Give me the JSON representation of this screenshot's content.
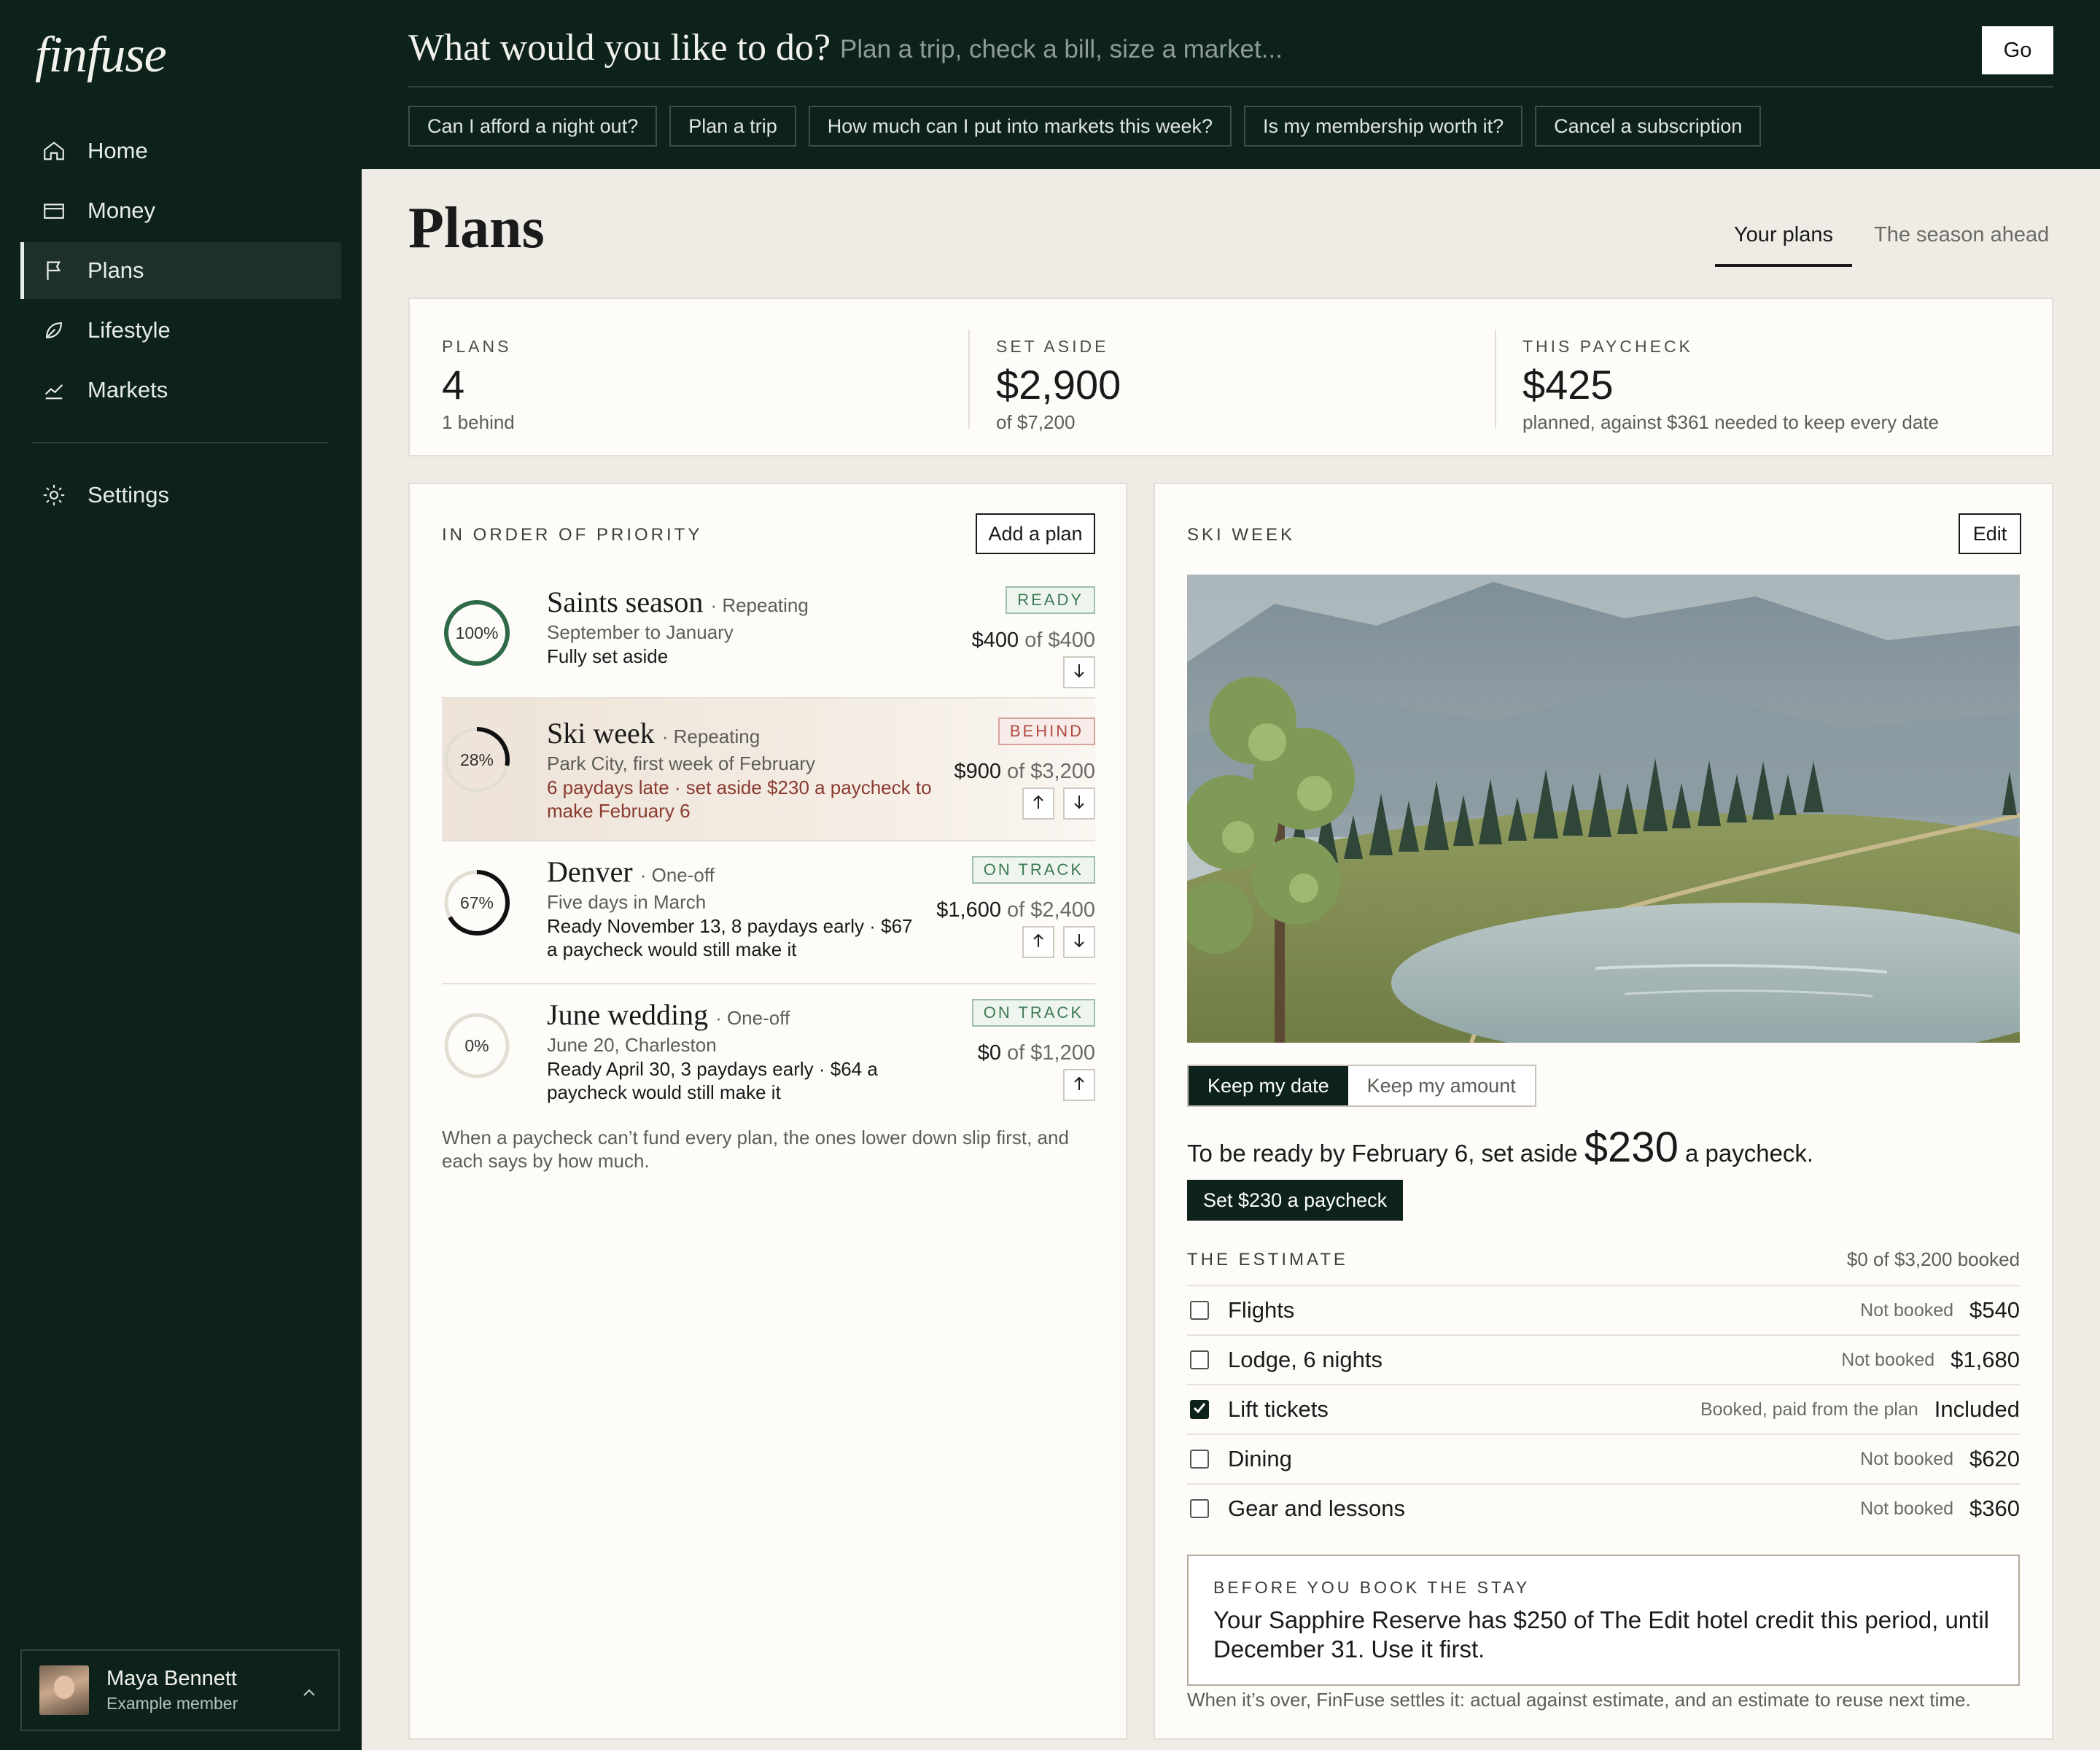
{
  "app": {
    "logo": "finfuse"
  },
  "sidebar": {
    "items": [
      {
        "label": "Home",
        "icon": "home-icon"
      },
      {
        "label": "Money",
        "icon": "wallet-icon"
      },
      {
        "label": "Plans",
        "icon": "flag-icon",
        "active": true
      },
      {
        "label": "Lifestyle",
        "icon": "leaf-icon"
      },
      {
        "label": "Markets",
        "icon": "chart-icon"
      }
    ],
    "settings": {
      "label": "Settings",
      "icon": "gear-icon"
    },
    "user": {
      "name": "Maya Bennett",
      "role": "Example member"
    }
  },
  "topbar": {
    "title": "What would you like to do?",
    "placeholder": "Plan a trip, check a bill, size a market...",
    "go_label": "Go",
    "chips": [
      "Can I afford a night out?",
      "Plan a trip",
      "How much can I put into markets this week?",
      "Is my membership worth it?",
      "Cancel a subscription"
    ]
  },
  "page": {
    "title": "Plans",
    "tabs": [
      "Your plans",
      "The season ahead"
    ]
  },
  "stats": [
    {
      "label": "PLANS",
      "value": "4",
      "sub": "1 behind"
    },
    {
      "label": "SET ASIDE",
      "value": "$2,900",
      "sub": "of $7,200"
    },
    {
      "label": "THIS PAYCHECK",
      "value": "$425",
      "sub": "planned, against $361 needed to keep every date"
    }
  ],
  "priority": {
    "label": "IN ORDER OF PRIORITY",
    "add_label": "Add a plan",
    "note": "When a paycheck can’t fund every plan, the ones lower down slip first, and each says by how much.",
    "plans": [
      {
        "name": "Saints season",
        "kind": "· Repeating",
        "sub": "September to January",
        "note": "Fully set aside",
        "status": "READY",
        "saved": "$400",
        "of": "of $400",
        "percent_label": "100%",
        "progress": 1.0
      },
      {
        "name": "Ski week",
        "kind": "· Repeating",
        "sub": "Park City, first week of February",
        "note": "6 paydays late · set aside $230 a paycheck to make February 6",
        "status": "BEHIND",
        "saved": "$900",
        "of": "of $3,200",
        "percent_label": "28%",
        "progress": 0.28
      },
      {
        "name": "Denver",
        "kind": "· One-off",
        "sub": "Five days in March",
        "note": "Ready November 13, 8 paydays early · $67 a paycheck would still make it",
        "status": "ON TRACK",
        "saved": "$1,600",
        "of": "of $2,400",
        "percent_label": "67%",
        "progress": 0.67
      },
      {
        "name": "June wedding",
        "kind": "· One-off",
        "sub": "June 20, Charleston",
        "note": "Ready April 30, 3 paydays early · $64 a paycheck would still make it",
        "status": "ON TRACK",
        "saved": "$0",
        "of": "of $1,200",
        "percent_label": "0%",
        "progress": 0.0
      }
    ]
  },
  "detail": {
    "label": "SKI WEEK",
    "edit_label": "Edit",
    "toggle": [
      "Keep my date",
      "Keep my amount"
    ],
    "ready_prefix": "To be ready by February 6, set aside",
    "ready_amount": "$230",
    "ready_suffix": "a paycheck.",
    "set_label": "Set $230 a paycheck",
    "estimate_label": "THE ESTIMATE",
    "estimate_total": "$0 of $3,200 booked",
    "estimate": [
      {
        "name": "Flights",
        "status": "Not booked",
        "price": "$540",
        "checked": false
      },
      {
        "name": "Lodge, 6 nights",
        "status": "Not booked",
        "price": "$1,680",
        "checked": false
      },
      {
        "name": "Lift tickets",
        "status": "Booked, paid from the plan",
        "price": "Included",
        "checked": true
      },
      {
        "name": "Dining",
        "status": "Not booked",
        "price": "$620",
        "checked": false
      },
      {
        "name": "Gear and lessons",
        "status": "Not booked",
        "price": "$360",
        "checked": false
      }
    ],
    "callout_label": "BEFORE YOU BOOK THE STAY",
    "callout_text": "Your Sapphire Reserve has $250 of The Edit hotel credit this period, until December 31. Use it first.",
    "settle_note": "When it’s over, FinFuse settles it: actual against estimate, and an estimate to reuse next time."
  },
  "colors": {
    "sidebar_bg": "#0d221a",
    "page_bg": "#efece6",
    "ready": "#3f7a54",
    "behind": "#b04a40"
  }
}
